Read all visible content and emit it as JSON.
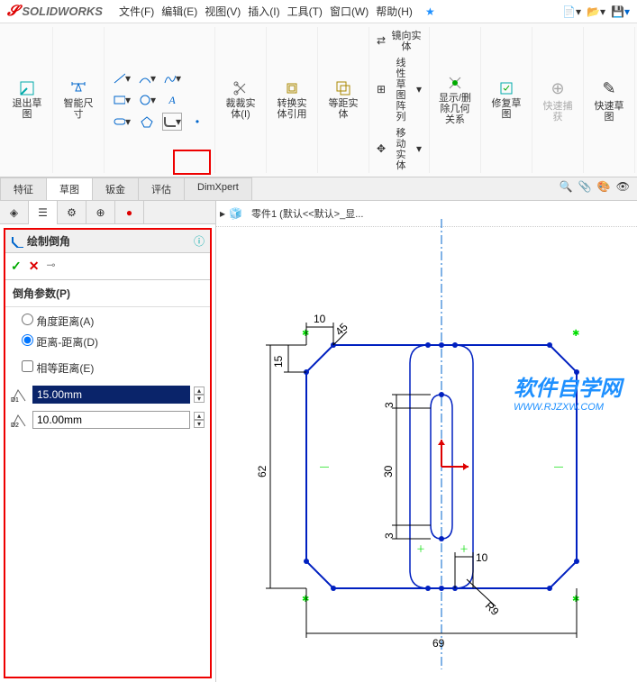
{
  "app": {
    "logo": "DS",
    "name": "SOLIDWORKS"
  },
  "menu": [
    "文件(F)",
    "编辑(E)",
    "视图(V)",
    "插入(I)",
    "工具(T)",
    "窗口(W)",
    "帮助(H)"
  ],
  "ribbon": {
    "btn_exit_sketch": "退出草图",
    "btn_smart_dim": "智能尺寸",
    "btn_trim": "裁裁实体(I)",
    "btn_convert": "转换实体引用",
    "btn_offset": "等距实体",
    "btn_mirror": "镜向实体",
    "btn_linear_pattern": "线性草图阵列",
    "btn_move": "移动实体",
    "btn_display": "显示/删除几何关系",
    "btn_repair": "修复草图",
    "btn_quick_snap": "快速捕获",
    "btn_quick_sketch": "快速草图"
  },
  "tabs": [
    "特征",
    "草图",
    "钣金",
    "评估",
    "DimXpert"
  ],
  "document": "零件1  (默认<<默认>_显...",
  "pm": {
    "title": "绘制倒角",
    "section": "倒角参数(P)",
    "opt_angle_dist": "角度距离(A)",
    "opt_dist_dist": "距离-距离(D)",
    "chk_equal": "相等距离(E)",
    "d1_label": "D1",
    "d1": "15.00mm",
    "d2_label": "D2",
    "d2": "10.00mm"
  },
  "sketch_dims": {
    "w_top": "10",
    "h_left": "15",
    "arc_45": "45",
    "h3a": "3",
    "h30": "30",
    "h3b": "3",
    "h_total": "62",
    "w_right": "10",
    "r": "R9",
    "w_bottom": "69"
  },
  "watermark": {
    "text": "软件自学网",
    "url": "WWW.RJZXW.COM"
  },
  "colors": {
    "highlight": "#e00",
    "sketch": "#0020c0",
    "accent": "#0aa"
  }
}
